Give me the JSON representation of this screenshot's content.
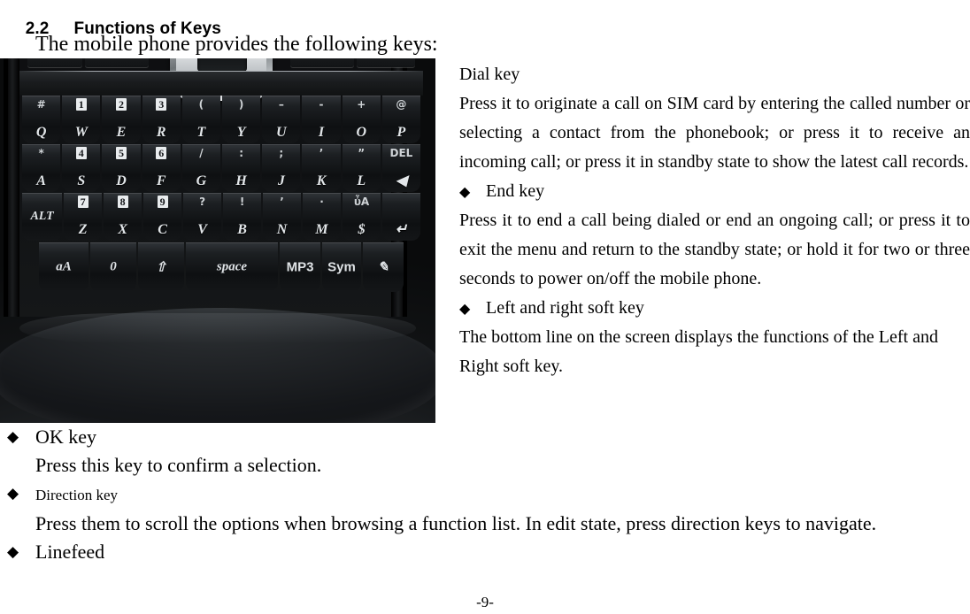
{
  "section": {
    "number": "2.2",
    "title": "Functions of Keys",
    "intro": "The mobile phone provides the following keys:"
  },
  "bullet_glyph": "◆",
  "right_column": {
    "items": [
      {
        "heading": "Dial key",
        "heading_has_bullet": false,
        "body": "Press it to originate a call on SIM card by entering the called number or selecting a contact from the phonebook; or press it to receive an incoming call; or press it in standby state to show the latest call records."
      },
      {
        "heading": "End key",
        "heading_has_bullet": true,
        "body": "Press it to end a call being dialed or end an ongoing call; or press it to exit the menu and return to the standby state; or hold it for two or three seconds to power on/off the mobile phone."
      },
      {
        "heading": "Left and right soft key",
        "heading_has_bullet": true,
        "body": "The bottom line on the screen displays the functions of the Left and Right soft key."
      }
    ]
  },
  "bottom_section": {
    "items": [
      {
        "heading": "OK key",
        "body": "Press this key to confirm a selection.",
        "heading_small": false
      },
      {
        "heading": "Direction key",
        "body": "Press them to scroll the options when browsing a function list. In edit state, press direction keys to navigate.",
        "heading_small": true
      },
      {
        "heading": "Linefeed",
        "body": "",
        "heading_small": false
      }
    ]
  },
  "page_number": "-9-",
  "phone": {
    "function_keys": {
      "send_label": "call-send",
      "left_soft_label": "left-soft",
      "right_soft_label": "right-soft",
      "end_label": "call-end-power"
    },
    "dpad": {
      "up": "˄",
      "down": "˅",
      "left": "‹",
      "right": "›"
    },
    "keyboard": {
      "row1": [
        {
          "top": "#",
          "bottom": "Q",
          "boxed": false
        },
        {
          "top": "1",
          "bottom": "W",
          "boxed": true
        },
        {
          "top": "2",
          "bottom": "E",
          "boxed": true
        },
        {
          "top": "3",
          "bottom": "R",
          "boxed": true
        },
        {
          "top": "(",
          "bottom": "T",
          "boxed": false
        },
        {
          "top": ")",
          "bottom": "Y",
          "boxed": false
        },
        {
          "top": "–",
          "bottom": "U",
          "boxed": false
        },
        {
          "top": "-",
          "bottom": "I",
          "boxed": false
        },
        {
          "top": "+",
          "bottom": "O",
          "boxed": false
        },
        {
          "top": "@",
          "bottom": "P",
          "boxed": false
        }
      ],
      "row2": [
        {
          "top": "*",
          "bottom": "A",
          "boxed": false
        },
        {
          "top": "4",
          "bottom": "S",
          "boxed": true
        },
        {
          "top": "5",
          "bottom": "D",
          "boxed": true
        },
        {
          "top": "6",
          "bottom": "F",
          "boxed": true
        },
        {
          "top": "/",
          "bottom": "G",
          "boxed": false
        },
        {
          "top": ":",
          "bottom": "H",
          "boxed": false
        },
        {
          "top": ";",
          "bottom": "J",
          "boxed": false
        },
        {
          "top": "’",
          "bottom": "K",
          "boxed": false
        },
        {
          "top": "”",
          "bottom": "L",
          "boxed": false
        },
        {
          "top": "DEL",
          "bottom": "◀",
          "boxed": false
        }
      ],
      "row3": [
        {
          "top": "",
          "bottom": "",
          "mid": "ALT",
          "boxed": false
        },
        {
          "top": "7",
          "bottom": "Z",
          "boxed": true
        },
        {
          "top": "8",
          "bottom": "X",
          "boxed": true
        },
        {
          "top": "9",
          "bottom": "C",
          "boxed": true
        },
        {
          "top": "?",
          "bottom": "V",
          "boxed": false
        },
        {
          "top": "!",
          "bottom": "B",
          "boxed": false
        },
        {
          "top": "’",
          "bottom": "N",
          "boxed": false
        },
        {
          "top": "·",
          "bottom": "M",
          "boxed": false
        },
        {
          "top": "ὖA",
          "bottom": "$",
          "boxed": false
        },
        {
          "top": "",
          "bottom": "↵",
          "boxed": false
        }
      ],
      "row4": [
        {
          "label": "aA",
          "name": "case-shift-key"
        },
        {
          "label": "0",
          "name": "zero-key"
        },
        {
          "label": "⇧",
          "name": "shift-key"
        },
        {
          "label": "space",
          "name": "space-key"
        },
        {
          "label": "MP3",
          "name": "mp3-key"
        },
        {
          "label": "Sym",
          "name": "symbol-key"
        },
        {
          "label": "✎",
          "name": "pencil-edit-key"
        }
      ]
    }
  }
}
